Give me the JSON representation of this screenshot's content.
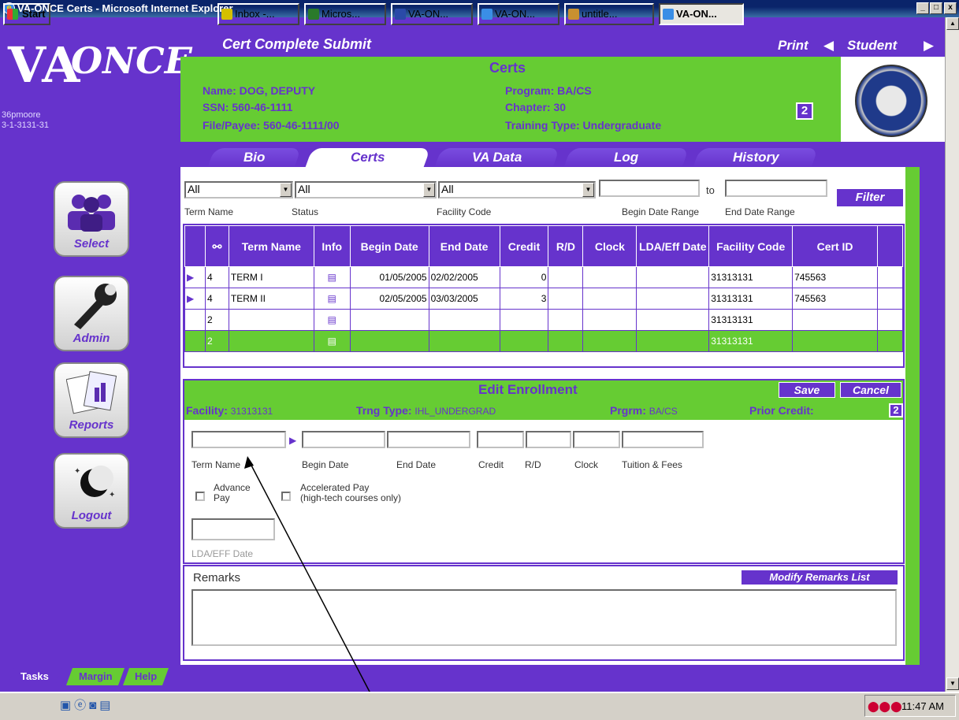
{
  "window": {
    "title": "VA-ONCE Certs - Microsoft Internet Explorer",
    "btn_min": "_",
    "btn_max": "□",
    "btn_close": "x"
  },
  "logo": {
    "va": "VA",
    "once": "ONCE",
    "user": "36pmoore",
    "facility": "3-1-3131-31"
  },
  "topmenu": {
    "left": "Cert Complete Submit",
    "print": "Print",
    "student": "Student"
  },
  "header": {
    "title": "Certs",
    "name": "Name: DOG, DEPUTY",
    "ssn": "SSN: 560-46-1111",
    "file_payee": "File/Payee: 560-46-1111/00",
    "program": "Program: BA/CS",
    "chapter": "Chapter: 30",
    "training_type": "Training Type: Undergraduate",
    "badge": "2"
  },
  "tabs": [
    "Bio",
    "Certs",
    "VA Data",
    "Log",
    "History"
  ],
  "filter": {
    "term_name_value": "All",
    "status_value": "All",
    "facility_value": "All",
    "to_label": "to",
    "filter_button": "Filter",
    "labels": {
      "term_name": "Term Name",
      "status": "Status",
      "facility": "Facility Code",
      "begin": "Begin Date Range",
      "end": "End Date Range"
    }
  },
  "grid": {
    "headers": [
      "",
      "",
      "Term Name",
      "Info",
      "Begin Date",
      "End Date",
      "Credit",
      "R/D",
      "Clock",
      "LDA/Eff Date",
      "Facility Code",
      "Cert ID",
      ""
    ],
    "rows": [
      {
        "marker": "▶",
        "num": "4",
        "term": "TERM I",
        "begin": "01/05/2005",
        "end": "02/02/2005",
        "credit": "0",
        "facility": "31313131",
        "cert": "745563"
      },
      {
        "marker": "▶",
        "num": "4",
        "term": "TERM II",
        "begin": "02/05/2005",
        "end": "03/03/2005",
        "credit": "3",
        "facility": "31313131",
        "cert": "745563"
      },
      {
        "marker": "",
        "num": "2",
        "term": "",
        "begin": "",
        "end": "",
        "credit": "",
        "facility": "31313131",
        "cert": ""
      },
      {
        "marker": "",
        "num": "2",
        "term": "",
        "begin": "",
        "end": "",
        "credit": "",
        "facility": "31313131",
        "cert": ""
      }
    ]
  },
  "edit": {
    "title": "Edit Enrollment",
    "save": "Save",
    "cancel": "Cancel",
    "facility_label": "Facility:",
    "facility_value": "31313131",
    "trng_label": "Trng Type:",
    "trng_value": "IHL_UNDERGRAD",
    "prgrm_label": "Prgrm:",
    "prgrm_value": "BA/CS",
    "prior_label": "Prior Credit:",
    "prior_value": "2",
    "field_labels": {
      "term": "Term Name",
      "begin": "Begin Date",
      "end": "End Date",
      "credit": "Credit",
      "rd": "R/D",
      "clock": "Clock",
      "tuition": "Tuition & Fees",
      "lda": "LDA/EFF Date"
    },
    "advance_pay_1": "Advance",
    "advance_pay_2": "Pay",
    "accel_pay_1": "Accelerated Pay",
    "accel_pay_2": "(high-tech courses only)"
  },
  "remarks": {
    "label": "Remarks",
    "modify_button": "Modify Remarks List"
  },
  "sidebar": [
    "Select",
    "Admin",
    "Reports",
    "Logout"
  ],
  "bottom_tabs": [
    "Tasks",
    "Margin",
    "Help"
  ],
  "taskbar": {
    "start": "Start",
    "items": [
      "Inbox -...",
      "Micros...",
      "VA-ON...",
      "VA-ON...",
      "untitle...",
      "VA-ON..."
    ],
    "clock": "11:47 AM"
  }
}
